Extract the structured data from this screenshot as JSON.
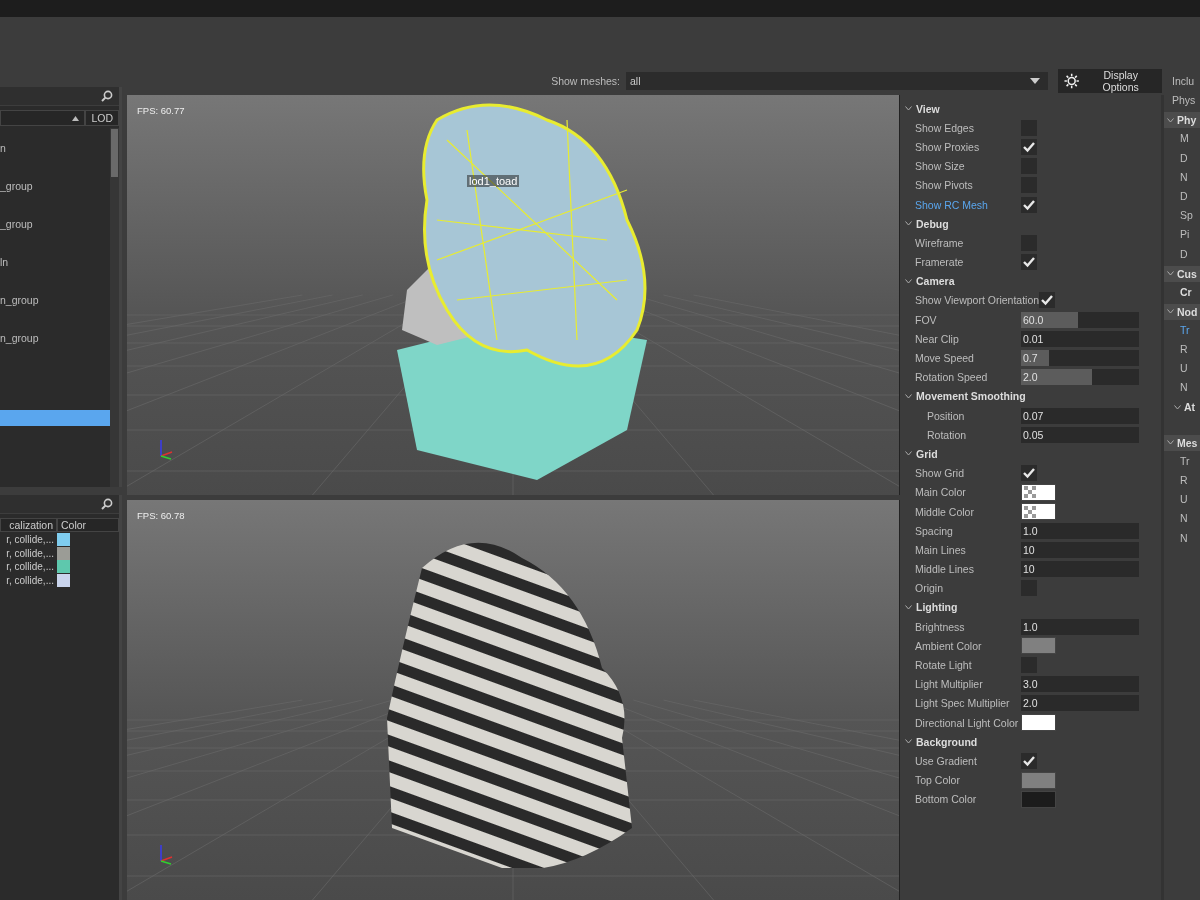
{
  "toolbar": {
    "meshes_label": "Show meshes:",
    "meshes_value": "all",
    "display_options": "Display Options"
  },
  "scene_tree": {
    "columns": [
      {
        "sorted": true
      },
      {
        "label": "LOD",
        "sorted": false
      }
    ],
    "items": [
      {
        "label": "n",
        "selected": false
      },
      {
        "label": "_group",
        "selected": false
      },
      {
        "label": "_group",
        "selected": false
      },
      {
        "label": "ln",
        "selected": false
      },
      {
        "label": "n_group",
        "selected": false
      },
      {
        "label": "n_group",
        "selected": false
      },
      {
        "selected": true
      }
    ]
  },
  "material_table": {
    "columns": [
      "calization",
      "Color"
    ],
    "rows": [
      {
        "column_1": "r, collide,...",
        "color": "#7fcdef"
      },
      {
        "column_1": "r, collide,...",
        "color": "#9b9c96"
      },
      {
        "column_1": "r, collide,...",
        "color": "#5ec8ad"
      },
      {
        "column_1": "r, collide,...",
        "color": "#c9d4ec"
      }
    ]
  },
  "viewports": [
    {
      "fps": "FPS: 60.77",
      "mesh_label": "lod1_toad",
      "kind": "wireframe"
    },
    {
      "fps": "FPS: 60.78",
      "kind": "textured"
    }
  ],
  "properties": [
    {
      "title": "View",
      "expanded": true,
      "rows": [
        {
          "label": "Show Edges",
          "kind": "checkbox",
          "checked": false
        },
        {
          "label": "Show Proxies",
          "kind": "checkbox",
          "checked": true
        },
        {
          "label": "Show Size",
          "kind": "checkbox",
          "checked": false
        },
        {
          "label": "Show Pivots",
          "kind": "checkbox",
          "checked": false
        },
        {
          "label": "Show RC Mesh",
          "kind": "checkbox",
          "checked": true,
          "highlighted": true
        }
      ]
    },
    {
      "title": "Debug",
      "expanded": true,
      "rows": [
        {
          "label": "Wireframe",
          "kind": "checkbox",
          "checked": false
        },
        {
          "label": "Framerate",
          "kind": "checkbox",
          "checked": true
        }
      ]
    },
    {
      "title": "Camera",
      "expanded": true,
      "rows": [
        {
          "label": "Show Viewport Orientation",
          "kind": "checkbox",
          "checked": true
        },
        {
          "label": "FOV",
          "kind": "slider",
          "value": "60.0",
          "level": 0.48
        },
        {
          "label": "Near Clip",
          "kind": "number",
          "value": "0.01"
        },
        {
          "label": "Move Speed",
          "kind": "slider",
          "value": "0.7",
          "level": 0.24
        },
        {
          "label": "Rotation Speed",
          "kind": "slider",
          "value": "2.0",
          "level": 0.6
        }
      ]
    },
    {
      "title": "Movement Smoothing",
      "expanded": true,
      "rows": [
        {
          "label": "Position",
          "kind": "number",
          "value": "0.07",
          "indented": true
        },
        {
          "label": "Rotation",
          "kind": "number",
          "value": "0.05",
          "indented": true
        }
      ]
    },
    {
      "title": "Grid",
      "expanded": true,
      "rows": [
        {
          "label": "Show Grid",
          "kind": "checkbox",
          "checked": true
        },
        {
          "label": "Main Color",
          "kind": "alpha-color",
          "color": "#ffffff"
        },
        {
          "label": "Middle Color",
          "kind": "alpha-color",
          "color": "#ffffff"
        },
        {
          "label": "Spacing",
          "kind": "number",
          "value": "1.0"
        },
        {
          "label": "Main Lines",
          "kind": "number",
          "value": "10"
        },
        {
          "label": "Middle Lines",
          "kind": "number",
          "value": "10"
        },
        {
          "label": "Origin",
          "kind": "checkbox",
          "checked": false
        }
      ]
    },
    {
      "title": "Lighting",
      "expanded": true,
      "rows": [
        {
          "label": "Brightness",
          "kind": "number",
          "value": "1.0"
        },
        {
          "label": "Ambient Color",
          "kind": "color",
          "color": "#808080"
        },
        {
          "label": "Rotate Light",
          "kind": "checkbox",
          "checked": false
        },
        {
          "label": "Light Multiplier",
          "kind": "number",
          "value": "3.0"
        },
        {
          "label": "Light Spec Multiplier",
          "kind": "number",
          "value": "2.0"
        },
        {
          "label": "Directional Light Color",
          "kind": "color",
          "color": "#ffffff"
        }
      ]
    },
    {
      "title": "Background",
      "expanded": true,
      "rows": [
        {
          "label": "Use Gradient",
          "kind": "checkbox",
          "checked": true
        },
        {
          "label": "Top Color",
          "kind": "color",
          "color": "#808080"
        },
        {
          "label": "Bottom Color",
          "kind": "color",
          "color": "#1c1c1c"
        }
      ]
    }
  ],
  "side_panel": {
    "items": [
      {
        "label": "Inclu"
      },
      {
        "label": "Phys"
      }
    ],
    "groups": [
      {
        "title": "Phy",
        "expanded": true,
        "items": [
          {
            "label": "M"
          },
          {
            "label": "D"
          },
          {
            "label": "N"
          },
          {
            "label": "D"
          },
          {
            "label": "Sp"
          },
          {
            "label": "Pi"
          },
          {
            "label": "D"
          }
        ]
      },
      {
        "title": "Cus",
        "expanded": true,
        "items": [
          {
            "label": "Cr",
            "bold": true
          }
        ]
      },
      {
        "title": "Nod",
        "expanded": true,
        "items": [
          {
            "label": "Tr",
            "highlighted": true
          },
          {
            "label": "R"
          },
          {
            "label": "U"
          },
          {
            "label": "N"
          }
        ],
        "subgroup": "At"
      },
      {
        "title": "Mes",
        "expanded": true,
        "items": [
          {
            "label": "Tr"
          },
          {
            "label": "R"
          },
          {
            "label": "U"
          },
          {
            "label": "N"
          },
          {
            "label": "N"
          }
        ]
      }
    ]
  }
}
